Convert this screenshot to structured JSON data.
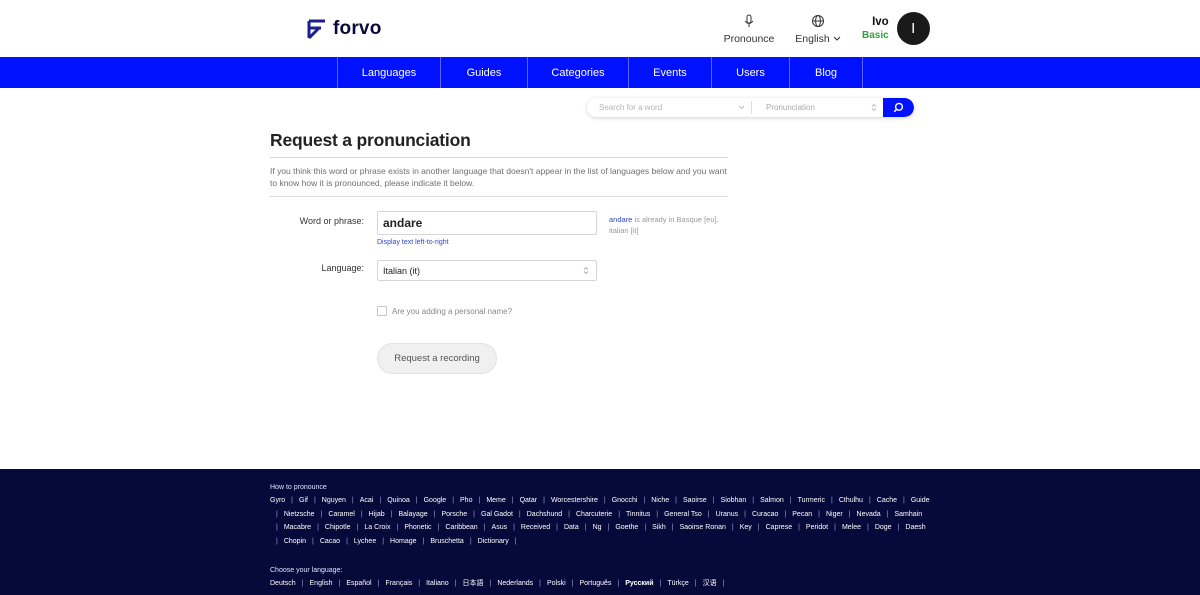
{
  "brand": {
    "name": "forvo"
  },
  "header": {
    "pronounce_label": "Pronounce",
    "language_label": "English",
    "user_name": "Ivo",
    "user_plan": "Basic",
    "avatar_initial": "I"
  },
  "nav": {
    "items": [
      {
        "label": "Languages"
      },
      {
        "label": "Guides"
      },
      {
        "label": "Categories"
      },
      {
        "label": "Events"
      },
      {
        "label": "Users"
      },
      {
        "label": "Blog"
      }
    ]
  },
  "search": {
    "placeholder": "Search for a word",
    "type_label": "Pronunciation"
  },
  "main": {
    "title": "Request a pronunciation",
    "intro": "If you think this word or phrase exists in another language that doesn't appear in the list of languages below and you want to know how it is pronounced, please indicate it below.",
    "word_label": "Word or phrase:",
    "word_value": "andare",
    "rtl_link": "Display text left-to-right",
    "hint_word": "andare",
    "hint_text": " is already in Basque [eu], italian [it]",
    "language_label": "Language:",
    "language_value": "Italian (it)",
    "checkbox_label": "Are you adding a personal name?",
    "submit_label": "Request a recording"
  },
  "footer": {
    "how_heading": "How to pronounce",
    "words": [
      "Gyro",
      "Gif",
      "Nguyen",
      "Acai",
      "Quinoa",
      "Google",
      "Pho",
      "Meme",
      "Qatar",
      "Worcestershire",
      "Gnocchi",
      "Niche",
      "Saoirse",
      "Siobhan",
      "Salmon",
      "Turmeric",
      "Cthulhu",
      "Cache",
      "Guide",
      "Nietzsche",
      "Caramel",
      "Hijab",
      "Balayage",
      "Porsche",
      "Gal Gadot",
      "Dachshund",
      "Charcuterie",
      "Tinnitus",
      "General Tso",
      "Uranus",
      "Curacao",
      "Pecan",
      "Niger",
      "Nevada",
      "Samhain",
      "Macabre",
      "Chipotle",
      "La Croix",
      "Phonetic",
      "Caribbean",
      "Asus",
      "Received",
      "Data",
      "Ng",
      "Goethe",
      "Sikh",
      "Saoirse Ronan",
      "Key",
      "Caprese",
      "Peridot",
      "Melee",
      "Doge",
      "Daesh",
      "Chopin",
      "Cacao",
      "Lychee",
      "Homage",
      "Bruschetta",
      "Dictionary"
    ],
    "lang_heading": "Choose your language:",
    "languages": [
      "Deutsch",
      "English",
      "Español",
      "Français",
      "Italiano",
      "日本語",
      "Nederlands",
      "Polski",
      "Português",
      "Русский",
      "Türkçe",
      "汉语"
    ]
  }
}
